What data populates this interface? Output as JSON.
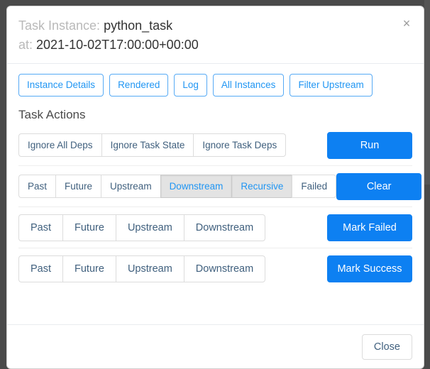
{
  "modal": {
    "title": {
      "label_task": "Task Instance:",
      "task_name": "python_task",
      "label_at": "at:",
      "execution_date": "2021-10-02T17:00:00+00:00"
    },
    "close_icon": "×",
    "tabs": [
      {
        "label": "Instance Details"
      },
      {
        "label": "Rendered"
      },
      {
        "label": "Log"
      },
      {
        "label": "All Instances"
      },
      {
        "label": "Filter Upstream"
      }
    ],
    "section_heading": "Task Actions",
    "action_rows": [
      {
        "name": "run",
        "size": "sm",
        "options": [
          {
            "label": "Ignore All Deps",
            "active": false
          },
          {
            "label": "Ignore Task State",
            "active": false
          },
          {
            "label": "Ignore Task Deps",
            "active": false
          }
        ],
        "action_label": "Run"
      },
      {
        "name": "clear",
        "size": "sm",
        "options": [
          {
            "label": "Past",
            "active": false
          },
          {
            "label": "Future",
            "active": false
          },
          {
            "label": "Upstream",
            "active": false
          },
          {
            "label": "Downstream",
            "active": true
          },
          {
            "label": "Recursive",
            "active": true
          },
          {
            "label": "Failed",
            "active": false
          }
        ],
        "action_label": "Clear"
      },
      {
        "name": "mark-failed",
        "size": "lg",
        "options": [
          {
            "label": "Past",
            "active": false
          },
          {
            "label": "Future",
            "active": false
          },
          {
            "label": "Upstream",
            "active": false
          },
          {
            "label": "Downstream",
            "active": false
          }
        ],
        "action_label": "Mark Failed"
      },
      {
        "name": "mark-success",
        "size": "lg",
        "options": [
          {
            "label": "Past",
            "active": false
          },
          {
            "label": "Future",
            "active": false
          },
          {
            "label": "Upstream",
            "active": false
          },
          {
            "label": "Downstream",
            "active": false
          }
        ],
        "action_label": "Mark Success"
      }
    ],
    "footer": {
      "close_label": "Close"
    }
  },
  "colors": {
    "primary": "#0d80f2",
    "tab_border": "#56aaf5",
    "tab_text": "#2196f3",
    "group_text": "#40607e",
    "active_bg": "#e3e3e3",
    "backdrop": "#4a4a4a"
  }
}
